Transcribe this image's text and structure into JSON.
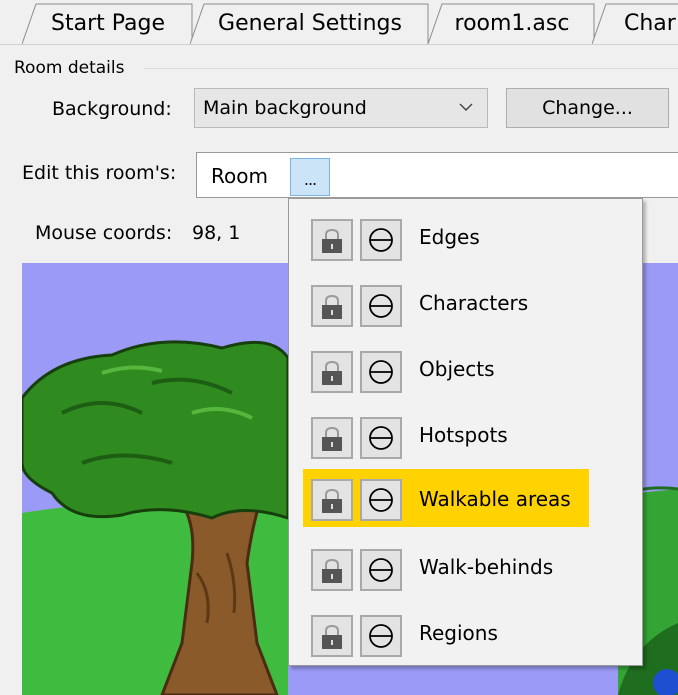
{
  "tabs": [
    {
      "label": "Start Page"
    },
    {
      "label": "General Settings"
    },
    {
      "label": "room1.asc"
    },
    {
      "label": "Char:"
    }
  ],
  "room_details": {
    "title": "Room details",
    "background_label": "Background:",
    "background_value": "Main background",
    "change_button": "Change...",
    "edit_label": "Edit this room's:",
    "edit_value": "Room",
    "dots_button": "...",
    "mouse_label": "Mouse coords:",
    "mouse_value": "98, 1"
  },
  "menu": {
    "items": [
      {
        "label": "Edges",
        "highlighted": false
      },
      {
        "label": "Characters",
        "highlighted": false
      },
      {
        "label": "Objects",
        "highlighted": false
      },
      {
        "label": "Hotspots",
        "highlighted": false
      },
      {
        "label": "Walkable areas",
        "highlighted": true
      },
      {
        "label": "Walk-behinds",
        "highlighted": false
      },
      {
        "label": "Regions",
        "highlighted": false
      }
    ]
  },
  "colors": {
    "highlight": "#ffd200",
    "sky": "#9b9bf7",
    "grass": "#3fbb3f",
    "foliage": "#2f8a1f",
    "trunk": "#8b5a2b"
  }
}
